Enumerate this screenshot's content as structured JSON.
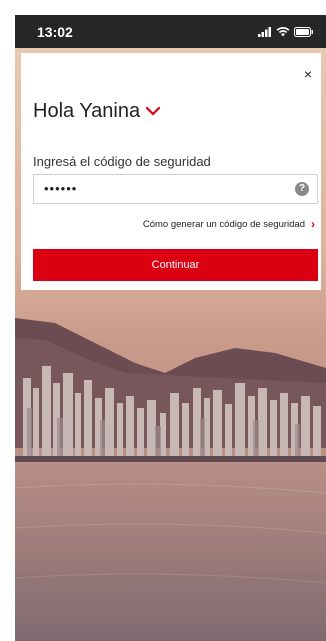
{
  "status_bar": {
    "time": "13:02",
    "icons": [
      "signal-icon",
      "wifi-icon",
      "battery-icon"
    ]
  },
  "login_card": {
    "close_icon": "×",
    "greeting": "Hola Yanina",
    "code_label": "Ingresá el código de seguridad",
    "code_value": "••••••",
    "help_icon": "?",
    "help_link": "Cómo generar un código de seguridad",
    "help_chevron": "›",
    "continue_label": "Continuar"
  },
  "colors": {
    "accent": "#db0011",
    "status_bar": "#262626",
    "card": "#ffffff"
  }
}
